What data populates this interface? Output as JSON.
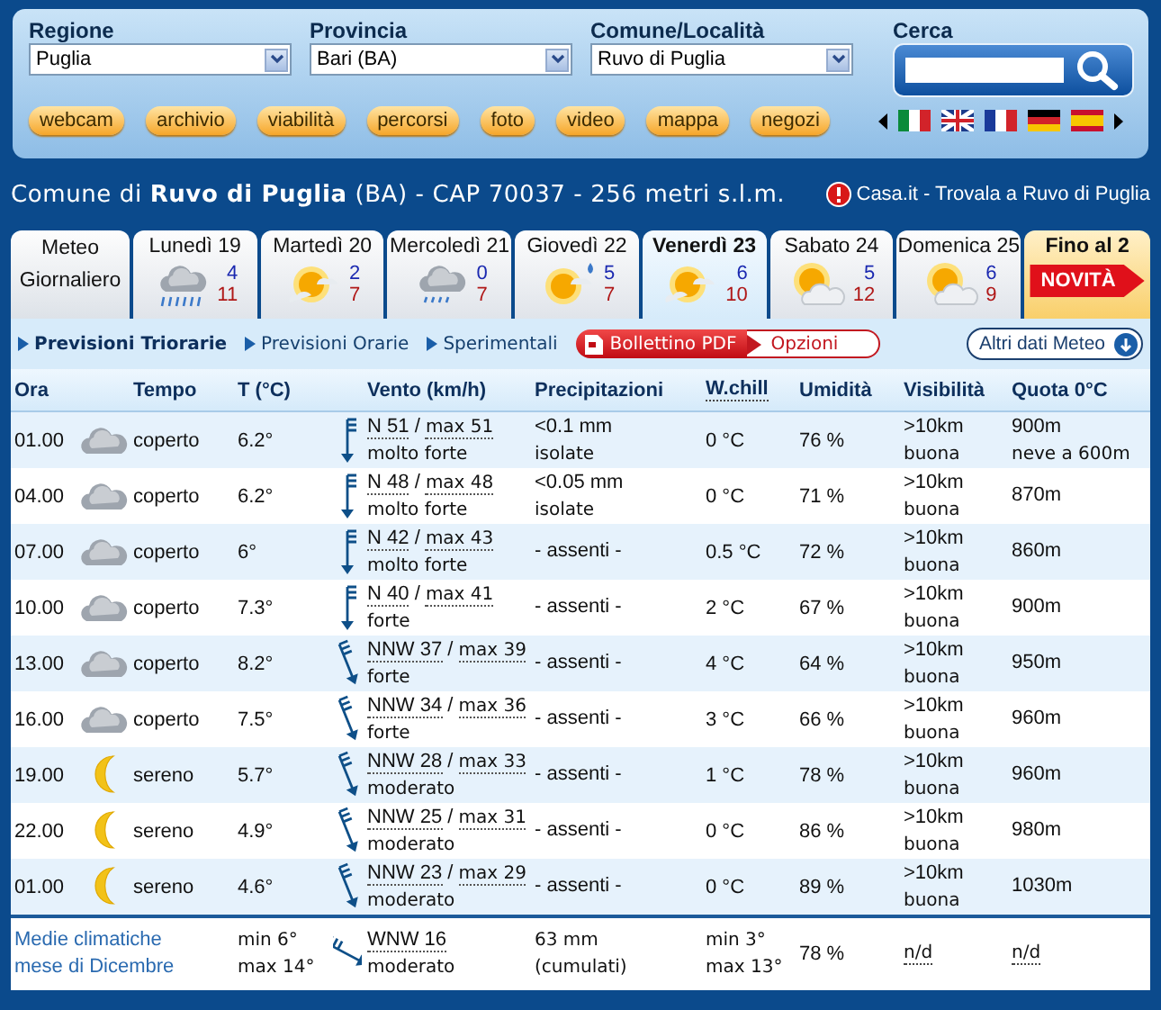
{
  "filters": [
    {
      "label": "Regione",
      "value": "Puglia"
    },
    {
      "label": "Provincia",
      "value": "Bari (BA)"
    },
    {
      "label": "Comune/Località",
      "value": "Ruvo di Puglia"
    }
  ],
  "search": {
    "label": "Cerca"
  },
  "links": [
    "webcam",
    "archivio",
    "viabilità",
    "percorsi",
    "foto",
    "video",
    "mappa",
    "negozi"
  ],
  "title": "Comune di **Ruvo di Puglia** (BA) - CAP 70037 - 256 metri s.l.m.",
  "promo": "Casa.it - Trovala a Ruvo di Puglia",
  "days": [
    {
      "kind": "summary",
      "label": "Meteo Giornaliero",
      "selected": false
    },
    {
      "kind": "day",
      "label": "Lunedì 19",
      "min": "4",
      "max": "11",
      "selected": false
    },
    {
      "kind": "day",
      "label": "Martedì 20",
      "min": "2",
      "max": "7",
      "selected": false
    },
    {
      "kind": "day",
      "label": "Mercoledì 21",
      "min": "0",
      "max": "7",
      "selected": false
    },
    {
      "kind": "day",
      "label": "Giovedì 22",
      "min": "5",
      "max": "7",
      "selected": false
    },
    {
      "kind": "day",
      "label": "Venerdì 23",
      "min": "6",
      "max": "10",
      "selected": true
    },
    {
      "kind": "day",
      "label": "Sabato 24",
      "min": "5",
      "max": "12",
      "selected": false
    },
    {
      "kind": "day",
      "label": "Domenica 25",
      "min": "6",
      "max": "9",
      "selected": false
    },
    {
      "kind": "promo",
      "label": "Fino al 2",
      "badge": "NOVITÀ",
      "selected": false
    }
  ],
  "views": [
    {
      "label": "Previsioni Triorarie",
      "selected": true
    },
    {
      "label": "Previsioni Orarie",
      "selected": false
    },
    {
      "label": "Sperimentali",
      "selected": false
    }
  ],
  "pdf_button": "Bollettino PDF",
  "options_button": "Opzioni",
  "more_button": "Altri dati Meteo",
  "columns": [
    "Ora",
    "Tempo",
    "T (°C)",
    "Vento (km/h)",
    "Precipitazioni",
    "W.chill",
    "Umidità",
    "Visibilità",
    "Quota 0°C"
  ],
  "rows": [
    {
      "time": "01.00",
      "kind": "cloudy",
      "sky_text": "coperto",
      "temp": "6.2°",
      "wind": [
        "N 51",
        "/",
        "max 51"
      ],
      "strength": "molto forte",
      "precip": [
        "<0.1 mm",
        "isolate"
      ],
      "wchill": "0 °C",
      "humidity": "76 %",
      "visibility": [
        ">10km",
        "buona"
      ],
      "quota": [
        "900m",
        "neve a 600m"
      ]
    },
    {
      "time": "04.00",
      "kind": "cloudy",
      "sky_text": "coperto",
      "temp": "6.2°",
      "wind": [
        "N 48",
        "/",
        "max 48"
      ],
      "strength": "molto forte",
      "precip": [
        "<0.05 mm",
        "isolate"
      ],
      "wchill": "0 °C",
      "humidity": "71 %",
      "visibility": [
        ">10km",
        "buona"
      ],
      "quota": [
        "870m"
      ]
    },
    {
      "time": "07.00",
      "kind": "cloudy",
      "sky_text": "coperto",
      "temp": "6°",
      "wind": [
        "N 42",
        "/",
        "max 43"
      ],
      "strength": "molto forte",
      "precip": [
        "- assenti -"
      ],
      "wchill": "0.5 °C",
      "humidity": "72 %",
      "visibility": [
        ">10km",
        "buona"
      ],
      "quota": [
        "860m"
      ]
    },
    {
      "time": "10.00",
      "kind": "cloudy",
      "sky_text": "coperto",
      "temp": "7.3°",
      "wind": [
        "N 40",
        "/",
        "max 41"
      ],
      "strength": "forte",
      "precip": [
        "- assenti -"
      ],
      "wchill": "2 °C",
      "humidity": "67 %",
      "visibility": [
        ">10km",
        "buona"
      ],
      "quota": [
        "900m"
      ]
    },
    {
      "time": "13.00",
      "kind": "cloudy",
      "sky_text": "coperto",
      "temp": "8.2°",
      "wind": [
        "NNW 37",
        "/",
        "max 39"
      ],
      "strength": "forte",
      "precip": [
        "- assenti -"
      ],
      "wchill": "4 °C",
      "humidity": "64 %",
      "visibility": [
        ">10km",
        "buona"
      ],
      "quota": [
        "950m"
      ]
    },
    {
      "time": "16.00",
      "kind": "cloudy",
      "sky_text": "coperto",
      "temp": "7.5°",
      "wind": [
        "NNW 34",
        "/",
        "max 36"
      ],
      "strength": "forte",
      "precip": [
        "- assenti -"
      ],
      "wchill": "3 °C",
      "humidity": "66 %",
      "visibility": [
        ">10km",
        "buona"
      ],
      "quota": [
        "960m"
      ]
    },
    {
      "time": "19.00",
      "kind": "clear",
      "sky_text": "sereno",
      "temp": "5.7°",
      "wind": [
        "NNW 28",
        "/",
        "max 33"
      ],
      "strength": "moderato",
      "precip": [
        "- assenti -"
      ],
      "wchill": "1 °C",
      "humidity": "78 %",
      "visibility": [
        ">10km",
        "buona"
      ],
      "quota": [
        "960m"
      ]
    },
    {
      "time": "22.00",
      "kind": "clear",
      "sky_text": "sereno",
      "temp": "4.9°",
      "wind": [
        "NNW 25",
        "/",
        "max 31"
      ],
      "strength": "moderato",
      "precip": [
        "- assenti -"
      ],
      "wchill": "0 °C",
      "humidity": "86 %",
      "visibility": [
        ">10km",
        "buona"
      ],
      "quota": [
        "980m"
      ]
    },
    {
      "time": "01.00",
      "kind": "clear",
      "sky_text": "sereno",
      "temp": "4.6°",
      "wind": [
        "NNW 23",
        "/",
        "max 29"
      ],
      "strength": "moderato",
      "precip": [
        "- assenti -"
      ],
      "wchill": "0 °C",
      "humidity": "89 %",
      "visibility": [
        ">10km",
        "buona"
      ],
      "quota": [
        "1030m"
      ]
    }
  ],
  "climate": {
    "label": "Medie climatiche mese di Dicembre",
    "temp": [
      "min 6°",
      "max 14°"
    ],
    "wind": "WNW 16",
    "strength": "moderato",
    "precip": [
      "63 mm",
      "(cumulati)"
    ],
    "wchill": [
      "min 3°",
      "max 13°"
    ],
    "humidity": "78 %",
    "visibility": "n/d",
    "quota": "n/d"
  }
}
